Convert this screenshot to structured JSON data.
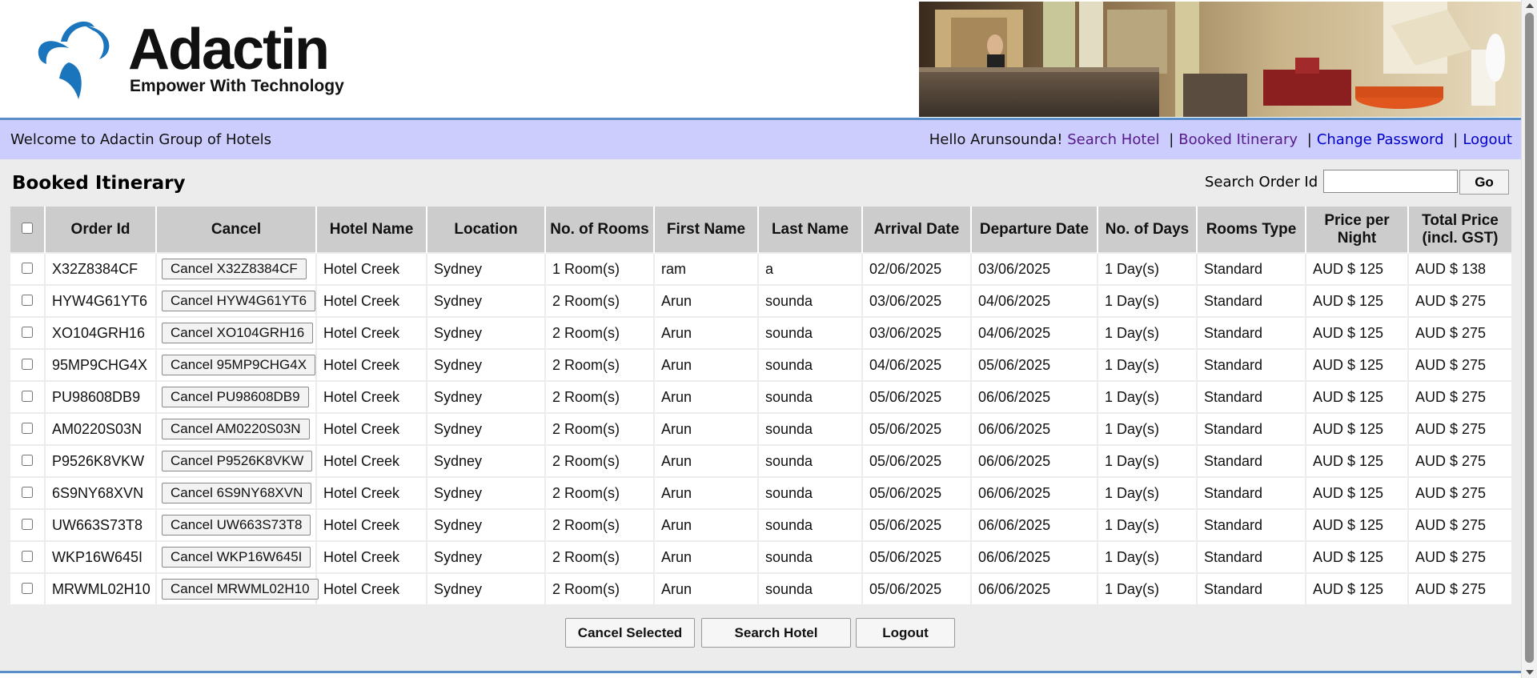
{
  "header": {
    "logo_text": "Adactin",
    "logo_tagline": "Empower With Technology"
  },
  "nav": {
    "welcome": "Welcome to Adactin Group of Hotels",
    "greeting": "Hello Arunsounda!",
    "links": [
      "Search Hotel",
      "Booked Itinerary",
      "Change Password",
      "Logout"
    ],
    "separator": "|"
  },
  "page": {
    "title": "Booked Itinerary",
    "search_label": "Search Order Id",
    "search_value": "",
    "go_label": "Go"
  },
  "table": {
    "headers": [
      "Order Id",
      "Cancel",
      "Hotel Name",
      "Location",
      "No. of Rooms",
      "First Name",
      "Last Name",
      "Arrival Date",
      "Departure Date",
      "No. of Days",
      "Rooms Type",
      "Price per Night",
      "Total Price (incl. GST)"
    ],
    "rows": [
      {
        "order_id": "X32Z8384CF",
        "cancel": "Cancel X32Z8384CF",
        "hotel": "Hotel Creek",
        "location": "Sydney",
        "rooms": "1 Room(s)",
        "first": "ram",
        "last": "a",
        "arrival": "02/06/2025",
        "departure": "03/06/2025",
        "days": "1 Day(s)",
        "type": "Standard",
        "price": "AUD $ 125",
        "total": "AUD $ 138"
      },
      {
        "order_id": "HYW4G61YT6",
        "cancel": "Cancel HYW4G61YT6",
        "hotel": "Hotel Creek",
        "location": "Sydney",
        "rooms": "2 Room(s)",
        "first": "Arun",
        "last": "sounda",
        "arrival": "03/06/2025",
        "departure": "04/06/2025",
        "days": "1 Day(s)",
        "type": "Standard",
        "price": "AUD $ 125",
        "total": "AUD $ 275"
      },
      {
        "order_id": "XO104GRH16",
        "cancel": "Cancel XO104GRH16",
        "hotel": "Hotel Creek",
        "location": "Sydney",
        "rooms": "2 Room(s)",
        "first": "Arun",
        "last": "sounda",
        "arrival": "03/06/2025",
        "departure": "04/06/2025",
        "days": "1 Day(s)",
        "type": "Standard",
        "price": "AUD $ 125",
        "total": "AUD $ 275"
      },
      {
        "order_id": "95MP9CHG4X",
        "cancel": "Cancel 95MP9CHG4X",
        "hotel": "Hotel Creek",
        "location": "Sydney",
        "rooms": "2 Room(s)",
        "first": "Arun",
        "last": "sounda",
        "arrival": "04/06/2025",
        "departure": "05/06/2025",
        "days": "1 Day(s)",
        "type": "Standard",
        "price": "AUD $ 125",
        "total": "AUD $ 275"
      },
      {
        "order_id": "PU98608DB9",
        "cancel": "Cancel PU98608DB9",
        "hotel": "Hotel Creek",
        "location": "Sydney",
        "rooms": "2 Room(s)",
        "first": "Arun",
        "last": "sounda",
        "arrival": "05/06/2025",
        "departure": "06/06/2025",
        "days": "1 Day(s)",
        "type": "Standard",
        "price": "AUD $ 125",
        "total": "AUD $ 275"
      },
      {
        "order_id": "AM0220S03N",
        "cancel": "Cancel AM0220S03N",
        "hotel": "Hotel Creek",
        "location": "Sydney",
        "rooms": "2 Room(s)",
        "first": "Arun",
        "last": "sounda",
        "arrival": "05/06/2025",
        "departure": "06/06/2025",
        "days": "1 Day(s)",
        "type": "Standard",
        "price": "AUD $ 125",
        "total": "AUD $ 275"
      },
      {
        "order_id": "P9526K8VKW",
        "cancel": "Cancel P9526K8VKW",
        "hotel": "Hotel Creek",
        "location": "Sydney",
        "rooms": "2 Room(s)",
        "first": "Arun",
        "last": "sounda",
        "arrival": "05/06/2025",
        "departure": "06/06/2025",
        "days": "1 Day(s)",
        "type": "Standard",
        "price": "AUD $ 125",
        "total": "AUD $ 275"
      },
      {
        "order_id": "6S9NY68XVN",
        "cancel": "Cancel 6S9NY68XVN",
        "hotel": "Hotel Creek",
        "location": "Sydney",
        "rooms": "2 Room(s)",
        "first": "Arun",
        "last": "sounda",
        "arrival": "05/06/2025",
        "departure": "06/06/2025",
        "days": "1 Day(s)",
        "type": "Standard",
        "price": "AUD $ 125",
        "total": "AUD $ 275"
      },
      {
        "order_id": "UW663S73T8",
        "cancel": "Cancel UW663S73T8",
        "hotel": "Hotel Creek",
        "location": "Sydney",
        "rooms": "2 Room(s)",
        "first": "Arun",
        "last": "sounda",
        "arrival": "05/06/2025",
        "departure": "06/06/2025",
        "days": "1 Day(s)",
        "type": "Standard",
        "price": "AUD $ 125",
        "total": "AUD $ 275"
      },
      {
        "order_id": "WKP16W645I",
        "cancel": "Cancel WKP16W645I",
        "hotel": "Hotel Creek",
        "location": "Sydney",
        "rooms": "2 Room(s)",
        "first": "Arun",
        "last": "sounda",
        "arrival": "05/06/2025",
        "departure": "06/06/2025",
        "days": "1 Day(s)",
        "type": "Standard",
        "price": "AUD $ 125",
        "total": "AUD $ 275"
      },
      {
        "order_id": "MRWML02H10",
        "cancel": "Cancel MRWML02H10",
        "hotel": "Hotel Creek",
        "location": "Sydney",
        "rooms": "2 Room(s)",
        "first": "Arun",
        "last": "sounda",
        "arrival": "05/06/2025",
        "departure": "06/06/2025",
        "days": "1 Day(s)",
        "type": "Standard",
        "price": "AUD $ 125",
        "total": "AUD $ 275"
      }
    ]
  },
  "actions": {
    "cancel_selected": "Cancel Selected",
    "search_hotel": "Search Hotel",
    "logout": "Logout"
  },
  "colors": {
    "navbar_bg": "#cccdfc",
    "content_bg": "#ececec",
    "header_row_bg": "#cccccc",
    "accent_line": "#5b8ec7",
    "logo_blue": "#1b75bc",
    "visited_link": "#551a8b",
    "link": "#0000cc"
  },
  "icons": [
    "logo-swirl-icon",
    "hotel-lobby-photo",
    "scroll-up-arrow-icon",
    "scroll-down-arrow-icon"
  ]
}
